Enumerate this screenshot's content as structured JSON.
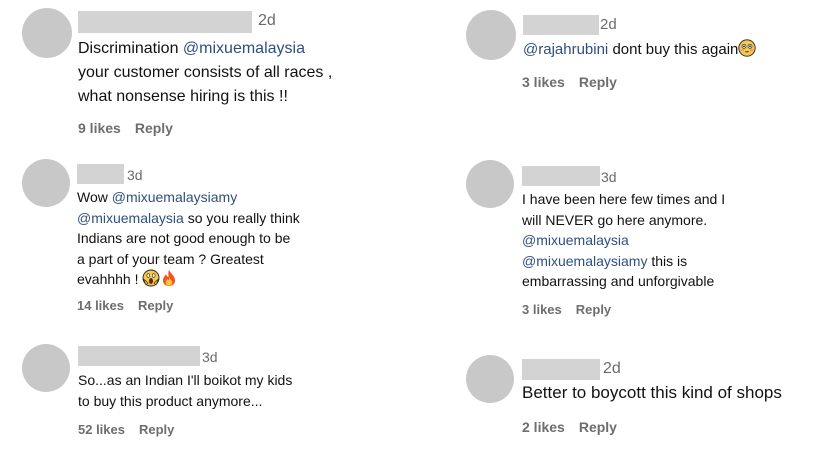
{
  "comments": [
    {
      "time": "2d",
      "text_parts": [
        {
          "t": "Discrimination ",
          "mention": false
        },
        {
          "t": "@mixuemalaysia",
          "mention": true
        },
        {
          "t": "\nyour customer consists of all races ,\nwhat nonsense hiring is this !!",
          "mention": false
        }
      ],
      "likes": "9 likes",
      "reply": "Reply"
    },
    {
      "time": "2d",
      "text_parts": [
        {
          "t": "@rajahrubini",
          "mention": true
        },
        {
          "t": " dont buy this again",
          "mention": false
        }
      ],
      "emoji": "flushed-face",
      "likes": "3 likes",
      "reply": "Reply"
    },
    {
      "time": "3d",
      "text_parts": [
        {
          "t": "Wow ",
          "mention": false
        },
        {
          "t": "@mixuemalaysiamy",
          "mention": true
        },
        {
          "t": "\n",
          "mention": false
        },
        {
          "t": "@mixuemalaysia",
          "mention": true
        },
        {
          "t": " so you really think\nIndians are not good enough to be\na part of your team ? Greatest\nevahhhh ! ",
          "mention": false
        }
      ],
      "emoji": "screaming-face-and-fire",
      "likes": "14 likes",
      "reply": "Reply"
    },
    {
      "time": "3d",
      "text_parts": [
        {
          "t": "I have been here few times and I\nwill NEVER go here anymore.\n",
          "mention": false
        },
        {
          "t": "@mixuemalaysia",
          "mention": true
        },
        {
          "t": "\n",
          "mention": false
        },
        {
          "t": "@mixuemalaysiamy",
          "mention": true
        },
        {
          "t": " this is\nembarrassing and unforgivable",
          "mention": false
        }
      ],
      "likes": "3 likes",
      "reply": "Reply"
    },
    {
      "time": "3d",
      "text_parts": [
        {
          "t": "So...as an Indian I'll boikot my kids\nto buy this product anymore...",
          "mention": false
        }
      ],
      "likes": "52 likes",
      "reply": "Reply"
    },
    {
      "time": "2d",
      "text_parts": [
        {
          "t": "Better to boycott this kind of shops",
          "mention": false
        }
      ],
      "likes": "2 likes",
      "reply": "Reply"
    }
  ]
}
